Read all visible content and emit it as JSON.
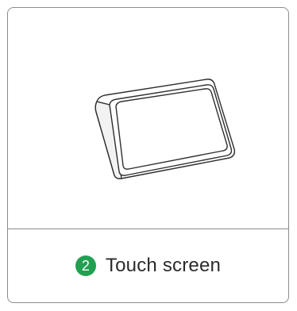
{
  "card": {
    "illustration": "touch-screen-device",
    "step_number": "2",
    "label": "Touch screen"
  },
  "colors": {
    "badge": "#22a052",
    "border": "#8c8c8c",
    "text": "#2b2b2b"
  }
}
